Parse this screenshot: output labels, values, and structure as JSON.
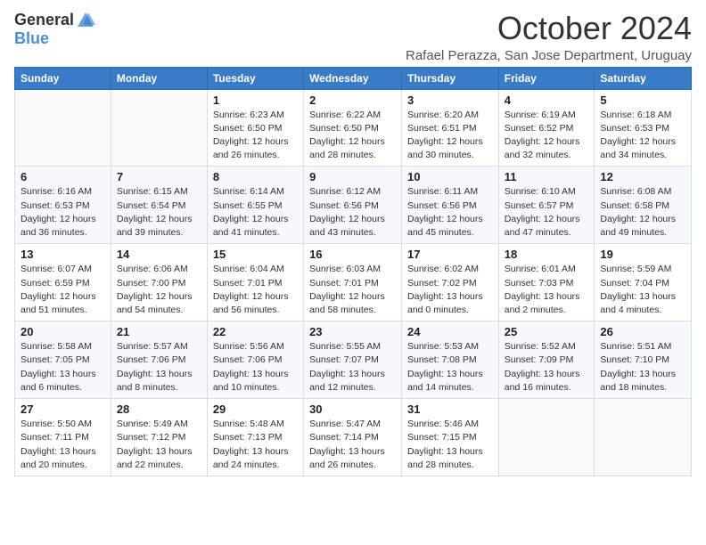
{
  "header": {
    "logo_general": "General",
    "logo_blue": "Blue",
    "month_title": "October 2024",
    "subtitle": "Rafael Perazza, San Jose Department, Uruguay"
  },
  "columns": [
    "Sunday",
    "Monday",
    "Tuesday",
    "Wednesday",
    "Thursday",
    "Friday",
    "Saturday"
  ],
  "weeks": [
    [
      {
        "day": "",
        "info": ""
      },
      {
        "day": "",
        "info": ""
      },
      {
        "day": "1",
        "info": "Sunrise: 6:23 AM\nSunset: 6:50 PM\nDaylight: 12 hours and 26 minutes."
      },
      {
        "day": "2",
        "info": "Sunrise: 6:22 AM\nSunset: 6:50 PM\nDaylight: 12 hours and 28 minutes."
      },
      {
        "day": "3",
        "info": "Sunrise: 6:20 AM\nSunset: 6:51 PM\nDaylight: 12 hours and 30 minutes."
      },
      {
        "day": "4",
        "info": "Sunrise: 6:19 AM\nSunset: 6:52 PM\nDaylight: 12 hours and 32 minutes."
      },
      {
        "day": "5",
        "info": "Sunrise: 6:18 AM\nSunset: 6:53 PM\nDaylight: 12 hours and 34 minutes."
      }
    ],
    [
      {
        "day": "6",
        "info": "Sunrise: 6:16 AM\nSunset: 6:53 PM\nDaylight: 12 hours and 36 minutes."
      },
      {
        "day": "7",
        "info": "Sunrise: 6:15 AM\nSunset: 6:54 PM\nDaylight: 12 hours and 39 minutes."
      },
      {
        "day": "8",
        "info": "Sunrise: 6:14 AM\nSunset: 6:55 PM\nDaylight: 12 hours and 41 minutes."
      },
      {
        "day": "9",
        "info": "Sunrise: 6:12 AM\nSunset: 6:56 PM\nDaylight: 12 hours and 43 minutes."
      },
      {
        "day": "10",
        "info": "Sunrise: 6:11 AM\nSunset: 6:56 PM\nDaylight: 12 hours and 45 minutes."
      },
      {
        "day": "11",
        "info": "Sunrise: 6:10 AM\nSunset: 6:57 PM\nDaylight: 12 hours and 47 minutes."
      },
      {
        "day": "12",
        "info": "Sunrise: 6:08 AM\nSunset: 6:58 PM\nDaylight: 12 hours and 49 minutes."
      }
    ],
    [
      {
        "day": "13",
        "info": "Sunrise: 6:07 AM\nSunset: 6:59 PM\nDaylight: 12 hours and 51 minutes."
      },
      {
        "day": "14",
        "info": "Sunrise: 6:06 AM\nSunset: 7:00 PM\nDaylight: 12 hours and 54 minutes."
      },
      {
        "day": "15",
        "info": "Sunrise: 6:04 AM\nSunset: 7:01 PM\nDaylight: 12 hours and 56 minutes."
      },
      {
        "day": "16",
        "info": "Sunrise: 6:03 AM\nSunset: 7:01 PM\nDaylight: 12 hours and 58 minutes."
      },
      {
        "day": "17",
        "info": "Sunrise: 6:02 AM\nSunset: 7:02 PM\nDaylight: 13 hours and 0 minutes."
      },
      {
        "day": "18",
        "info": "Sunrise: 6:01 AM\nSunset: 7:03 PM\nDaylight: 13 hours and 2 minutes."
      },
      {
        "day": "19",
        "info": "Sunrise: 5:59 AM\nSunset: 7:04 PM\nDaylight: 13 hours and 4 minutes."
      }
    ],
    [
      {
        "day": "20",
        "info": "Sunrise: 5:58 AM\nSunset: 7:05 PM\nDaylight: 13 hours and 6 minutes."
      },
      {
        "day": "21",
        "info": "Sunrise: 5:57 AM\nSunset: 7:06 PM\nDaylight: 13 hours and 8 minutes."
      },
      {
        "day": "22",
        "info": "Sunrise: 5:56 AM\nSunset: 7:06 PM\nDaylight: 13 hours and 10 minutes."
      },
      {
        "day": "23",
        "info": "Sunrise: 5:55 AM\nSunset: 7:07 PM\nDaylight: 13 hours and 12 minutes."
      },
      {
        "day": "24",
        "info": "Sunrise: 5:53 AM\nSunset: 7:08 PM\nDaylight: 13 hours and 14 minutes."
      },
      {
        "day": "25",
        "info": "Sunrise: 5:52 AM\nSunset: 7:09 PM\nDaylight: 13 hours and 16 minutes."
      },
      {
        "day": "26",
        "info": "Sunrise: 5:51 AM\nSunset: 7:10 PM\nDaylight: 13 hours and 18 minutes."
      }
    ],
    [
      {
        "day": "27",
        "info": "Sunrise: 5:50 AM\nSunset: 7:11 PM\nDaylight: 13 hours and 20 minutes."
      },
      {
        "day": "28",
        "info": "Sunrise: 5:49 AM\nSunset: 7:12 PM\nDaylight: 13 hours and 22 minutes."
      },
      {
        "day": "29",
        "info": "Sunrise: 5:48 AM\nSunset: 7:13 PM\nDaylight: 13 hours and 24 minutes."
      },
      {
        "day": "30",
        "info": "Sunrise: 5:47 AM\nSunset: 7:14 PM\nDaylight: 13 hours and 26 minutes."
      },
      {
        "day": "31",
        "info": "Sunrise: 5:46 AM\nSunset: 7:15 PM\nDaylight: 13 hours and 28 minutes."
      },
      {
        "day": "",
        "info": ""
      },
      {
        "day": "",
        "info": ""
      }
    ]
  ]
}
